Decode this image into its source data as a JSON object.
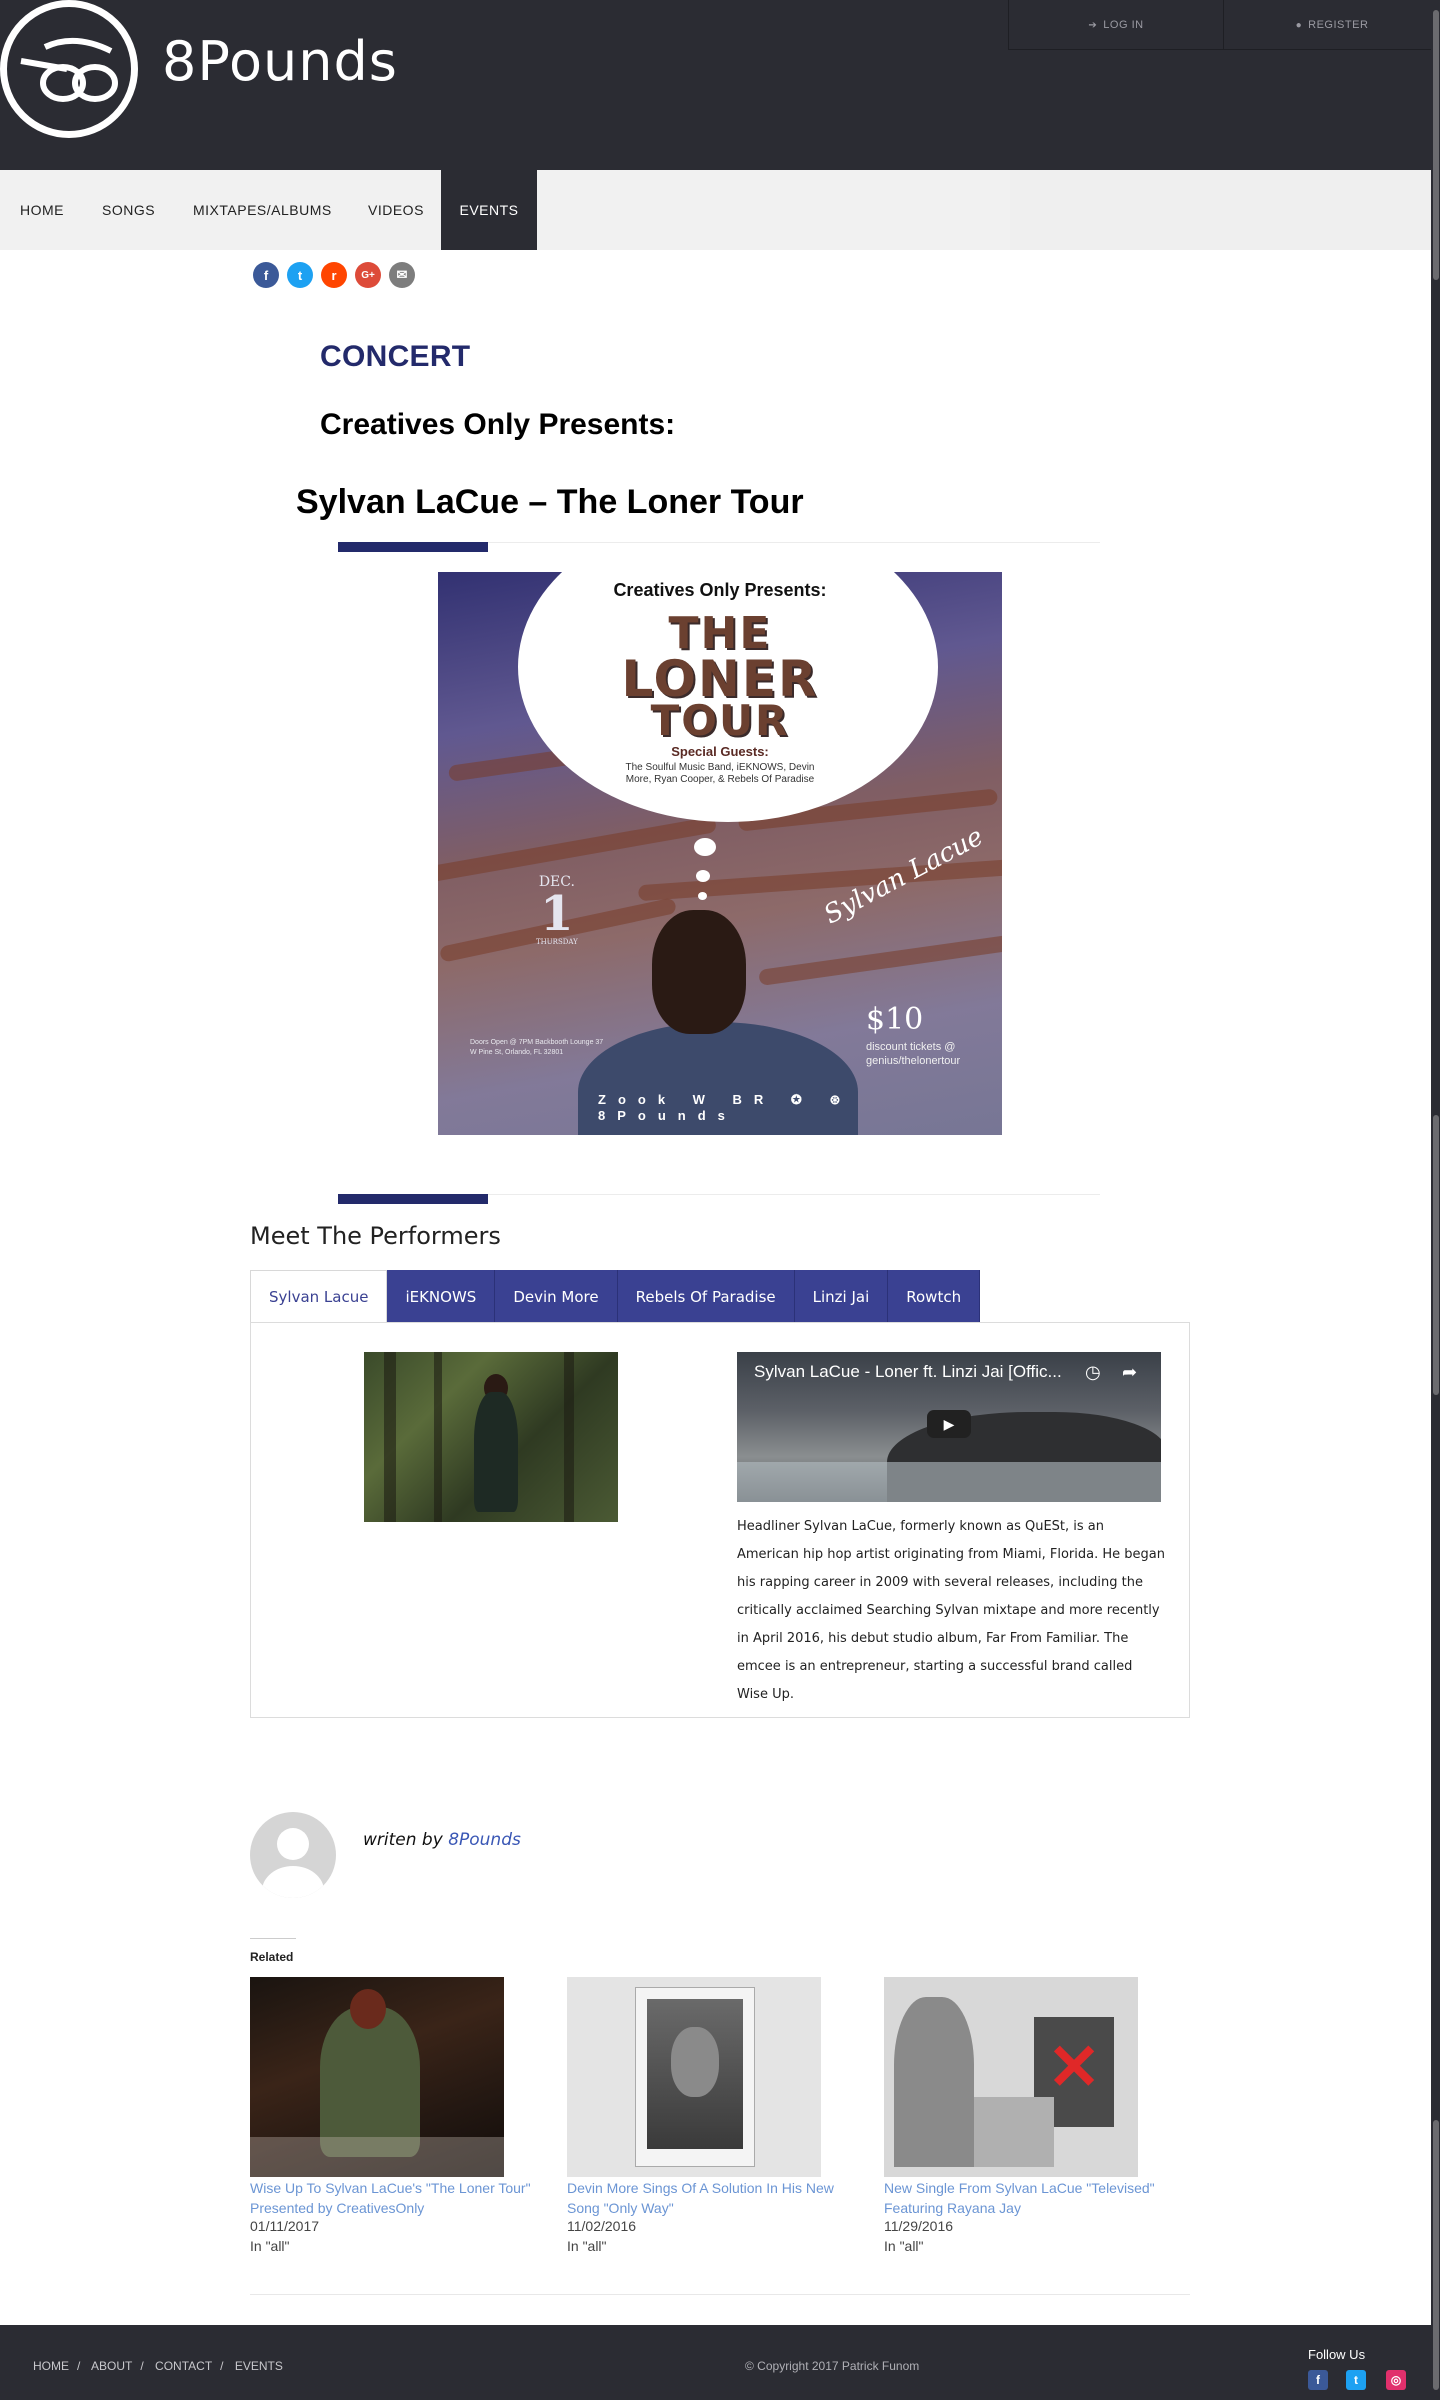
{
  "site": {
    "name": "8Pounds"
  },
  "top_bar": {
    "login": "LOG IN",
    "register": "REGISTER"
  },
  "nav": {
    "items": [
      "HOME",
      "SONGS",
      "MIXTAPES/ALBUMS",
      "VIDEOS",
      "EVENTS"
    ],
    "active": "EVENTS"
  },
  "share": [
    {
      "icon": "facebook-icon",
      "glyph": "f",
      "color": "#3b5998"
    },
    {
      "icon": "twitter-icon",
      "glyph": "t",
      "color": "#1da1f2"
    },
    {
      "icon": "reddit-icon",
      "glyph": "r",
      "color": "#ff4500"
    },
    {
      "icon": "google-plus-icon",
      "glyph": "G+",
      "color": "#dd4b39"
    },
    {
      "icon": "email-icon",
      "glyph": "✉",
      "color": "#7d7d7d"
    }
  ],
  "article": {
    "category": "CONCERT",
    "presents": "Creatives Only Presents:",
    "title": "Sylvan LaCue – The Loner Tour"
  },
  "poster": {
    "presents": "Creatives Only Presents:",
    "title_line1": "THE",
    "title_line2": "LONER",
    "title_line3": "TOUR",
    "guests_heading": "Special Guests:",
    "guests": "The Soulful Music Band, iEKNOWS, Devin More, Ryan Cooper, & Rebels Of Paradise",
    "date_month": "DEC.",
    "date_day": "1",
    "date_weekday": "THURSDAY",
    "signature": "Sylvan Lacue",
    "price": "$10",
    "discount": "discount tickets @ genius/thelonertour",
    "doors": "Doors Open @ 7PM Backbooth Lounge 37 W Pine St, Orlando, FL 32801",
    "logos": "Zook W BR ✪ ⊛ 8Pounds"
  },
  "performers": {
    "heading": "Meet The Performers",
    "tabs": [
      "Sylvan Lacue",
      "iEKNOWS",
      "Devin More",
      "Rebels Of Paradise",
      "Linzi Jai",
      "Rowtch"
    ],
    "active_tab": "Sylvan Lacue",
    "video_title": "Sylvan LaCue - Loner ft. Linzi Jai [Offic...",
    "bio": "Headliner Sylvan LaCue, formerly known as QuESt, is an American hip hop artist originating from Miami, Florida. He began his rapping career in 2009 with several releases, including the critically acclaimed Searching Sylvan mixtape and more recently in April 2016, his debut studio album, Far From Familiar. The emcee is an entrepreneur, starting a successful brand called Wise Up."
  },
  "author": {
    "prefix": "writen by",
    "name": "8Pounds"
  },
  "related": {
    "heading": "Related",
    "items": [
      {
        "title": "Wise Up To Sylvan LaCue's \"The Loner Tour\" Presented by CreativesOnly",
        "date": "01/11/2017",
        "category": "In \"all\""
      },
      {
        "title": "Devin More Sings Of A Solution In His New Song \"Only Way\"",
        "date": "11/02/2016",
        "category": "In \"all\""
      },
      {
        "title": "New Single From Sylvan LaCue \"Televised\" Featuring Rayana Jay",
        "date": "11/29/2016",
        "category": "In \"all\""
      }
    ]
  },
  "footer": {
    "nav": [
      "HOME",
      "ABOUT",
      "CONTACT",
      "EVENTS"
    ],
    "copyright": "© Copyright 2017 Patrick Funom",
    "follow": "Follow Us",
    "social": [
      {
        "icon": "facebook-icon",
        "glyph": "f",
        "color": "#3b5998"
      },
      {
        "icon": "twitter-icon",
        "glyph": "t",
        "color": "#1da1f2"
      },
      {
        "icon": "instagram-icon",
        "glyph": "◎",
        "color": "#e1306c"
      }
    ]
  },
  "colors": {
    "header_bg": "#2b2c33",
    "accent": "#232a6b",
    "tab_bg": "#3a4192",
    "link": "#6b95d4"
  }
}
